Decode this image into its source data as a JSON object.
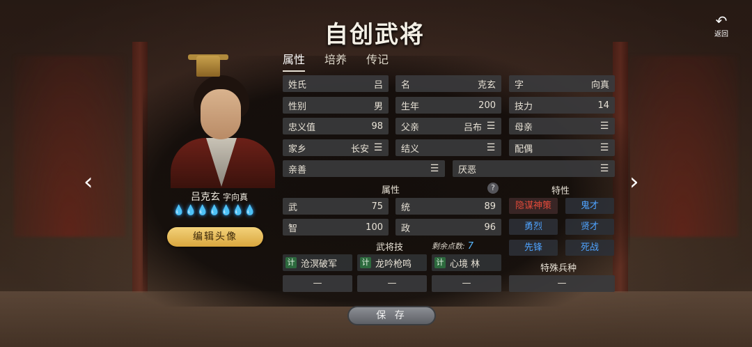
{
  "header": {
    "title": "自创武将",
    "back_label": "返回",
    "back_icon": "↶"
  },
  "tabs": [
    {
      "label": "属性",
      "active": true
    },
    {
      "label": "培养",
      "active": false
    },
    {
      "label": "传记",
      "active": false
    }
  ],
  "character": {
    "display_name": "吕克玄",
    "courtesy_display": "字向真",
    "flames": [
      "💧",
      "💧",
      "💧",
      "💧",
      "💧",
      "💧",
      "💧"
    ],
    "edit_avatar_label": "编辑头像"
  },
  "profile": {
    "surname": {
      "label": "姓氏",
      "value": "吕"
    },
    "given_name": {
      "label": "名",
      "value": "克玄"
    },
    "courtesy": {
      "label": "字",
      "value": "向真"
    },
    "gender": {
      "label": "性别",
      "value": "男"
    },
    "birth_year": {
      "label": "生年",
      "value": "200"
    },
    "skill_power": {
      "label": "技力",
      "value": "14"
    },
    "loyalty": {
      "label": "忠义值",
      "value": "98"
    },
    "father": {
      "label": "父亲",
      "value": "吕布"
    },
    "mother": {
      "label": "母亲",
      "value": ""
    },
    "hometown": {
      "label": "家乡",
      "value": "长安"
    },
    "sworn": {
      "label": "结义",
      "value": ""
    },
    "spouse": {
      "label": "配偶",
      "value": ""
    },
    "friendly": {
      "label": "亲善",
      "value": ""
    },
    "hated": {
      "label": "厌恶",
      "value": ""
    },
    "menu_icon": "☰"
  },
  "attributes": {
    "section_label": "属性",
    "help": "?",
    "war": {
      "label": "武",
      "value": "75"
    },
    "lead": {
      "label": "统",
      "value": "89"
    },
    "intel": {
      "label": "智",
      "value": "100"
    },
    "politics": {
      "label": "政",
      "value": "96"
    }
  },
  "traits": {
    "section_label": "特性",
    "items": [
      {
        "label": "隐谋神策",
        "color": "#e04a3a"
      },
      {
        "label": "鬼才",
        "color": "#4fa3ff"
      },
      {
        "label": "勇烈",
        "color": "#4fa3ff"
      },
      {
        "label": "贤才",
        "color": "#4fa3ff"
      },
      {
        "label": "先锋",
        "color": "#4fa3ff"
      },
      {
        "label": "死战",
        "color": "#4fa3ff"
      }
    ]
  },
  "skills": {
    "section_label": "武将技",
    "remaining_label": "剩余点数:",
    "remaining_value": "7",
    "items": [
      {
        "tag": "计",
        "name": "沧溟破军"
      },
      {
        "tag": "计",
        "name": "龙吟枪鸣"
      },
      {
        "tag": "计",
        "name": "心境 林"
      }
    ],
    "slots": [
      "—",
      "—",
      "—"
    ]
  },
  "special_troop": {
    "label": "特殊兵种",
    "value": "—"
  },
  "footer": {
    "save_label": "保 存"
  },
  "nav": {
    "prev_icon": "‹",
    "next_icon": "›"
  }
}
